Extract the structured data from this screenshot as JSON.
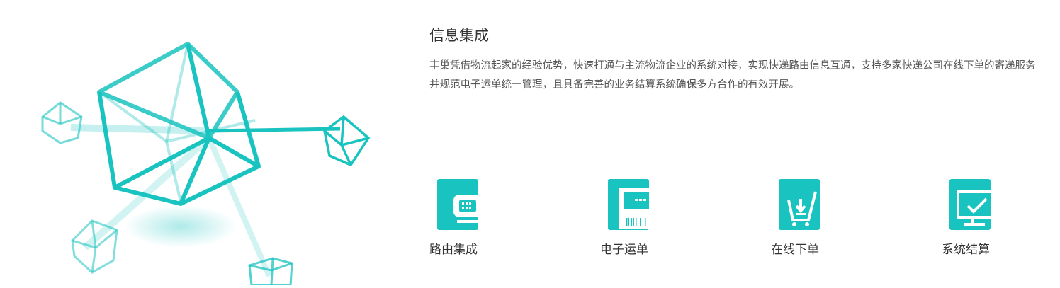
{
  "section": {
    "title": "信息集成",
    "description": "丰巢凭借物流起家的经验优势，快速打通与主流物流企业的系统对接，实现快递路由信息互通，支持多家快递公司在线下单的寄递服务并规范电子运单统一管理，且具备完善的业务结算系统确保多方合作的有效开展。"
  },
  "features": [
    {
      "label": "路由集成",
      "icon": "router-icon"
    },
    {
      "label": "电子运单",
      "icon": "waybill-icon"
    },
    {
      "label": "在线下单",
      "icon": "cart-order-icon"
    },
    {
      "label": "系统结算",
      "icon": "settlement-monitor-icon"
    }
  ],
  "colors": {
    "accent": "#19c3c0",
    "text": "#333333",
    "muted": "#555555"
  }
}
